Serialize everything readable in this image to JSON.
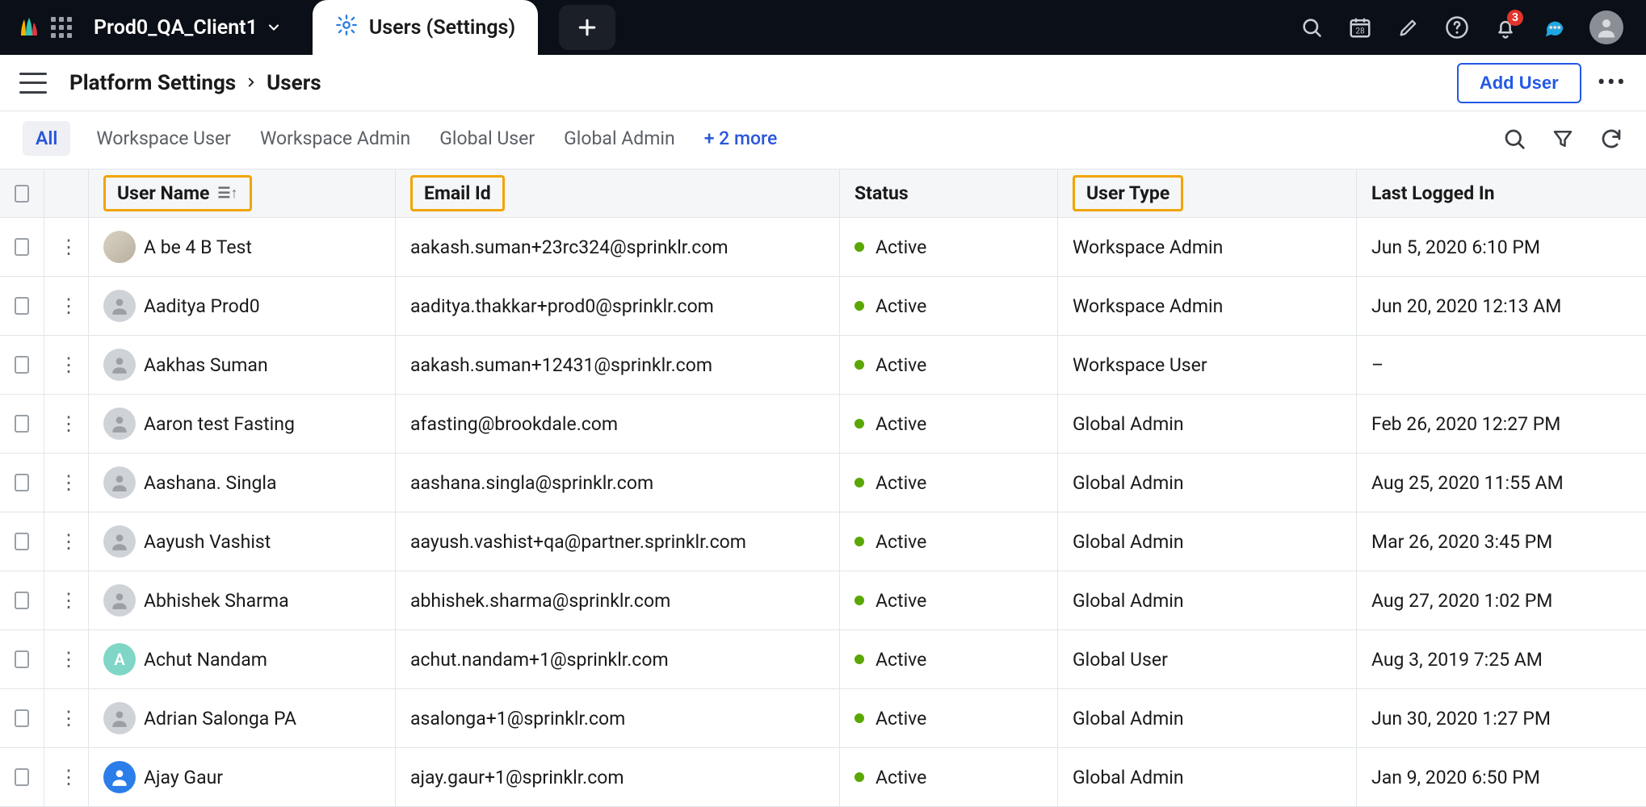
{
  "topbar": {
    "workspace": "Prod0_QA_Client1",
    "active_tab": "Users (Settings)",
    "notif_count": "3"
  },
  "breadcrumb": {
    "root": "Platform Settings",
    "leaf": "Users",
    "add_btn": "Add User"
  },
  "filters": {
    "all": "All",
    "f1": "Workspace User",
    "f2": "Workspace Admin",
    "f3": "Global User",
    "f4": "Global Admin",
    "more": "+ 2 more"
  },
  "columns": {
    "c1": "User Name",
    "c2": "Email Id",
    "c3": "Status",
    "c4": "User Type",
    "c5": "Last Logged In"
  },
  "rows": [
    {
      "name": "A be 4 B Test",
      "email": "aakash.suman+23rc324@sprinklr.com",
      "status": "Active",
      "type": "Workspace Admin",
      "login": "Jun 5, 2020 6:10 PM",
      "avatar": "img"
    },
    {
      "name": "Aaditya Prod0",
      "email": "aaditya.thakkar+prod0@sprinklr.com",
      "status": "Active",
      "type": "Workspace Admin",
      "login": "Jun 20, 2020 12:13 AM",
      "avatar": "gray"
    },
    {
      "name": "Aakhas Suman",
      "email": "aakash.suman+12431@sprinklr.com",
      "status": "Active",
      "type": "Workspace User",
      "login": "–",
      "avatar": "gray"
    },
    {
      "name": "Aaron test Fasting",
      "email": "afasting@brookdale.com",
      "status": "Active",
      "type": "Global Admin",
      "login": "Feb 26, 2020 12:27 PM",
      "avatar": "gray"
    },
    {
      "name": "Aashana. Singla",
      "email": "aashana.singla@sprinklr.com",
      "status": "Active",
      "type": "Global Admin",
      "login": "Aug 25, 2020 11:55 AM",
      "avatar": "gray"
    },
    {
      "name": "Aayush Vashist",
      "email": "aayush.vashist+qa@partner.sprinklr.com",
      "status": "Active",
      "type": "Global Admin",
      "login": "Mar 26, 2020 3:45 PM",
      "avatar": "gray"
    },
    {
      "name": "Abhishek Sharma",
      "email": "abhishek.sharma@sprinklr.com",
      "status": "Active",
      "type": "Global Admin",
      "login": "Aug 27, 2020 1:02 PM",
      "avatar": "gray"
    },
    {
      "name": "Achut Nandam",
      "email": "achut.nandam+1@sprinklr.com",
      "status": "Active",
      "type": "Global User",
      "login": "Aug 3, 2019 7:25 AM",
      "avatar": "green",
      "initial": "A"
    },
    {
      "name": "Adrian Salonga PA",
      "email": "asalonga+1@sprinklr.com",
      "status": "Active",
      "type": "Global Admin",
      "login": "Jun 30, 2020 1:27 PM",
      "avatar": "gray"
    },
    {
      "name": "Ajay Gaur",
      "email": "ajay.gaur+1@sprinklr.com",
      "status": "Active",
      "type": "Global Admin",
      "login": "Jan 9, 2020 6:50 PM",
      "avatar": "blue"
    }
  ]
}
